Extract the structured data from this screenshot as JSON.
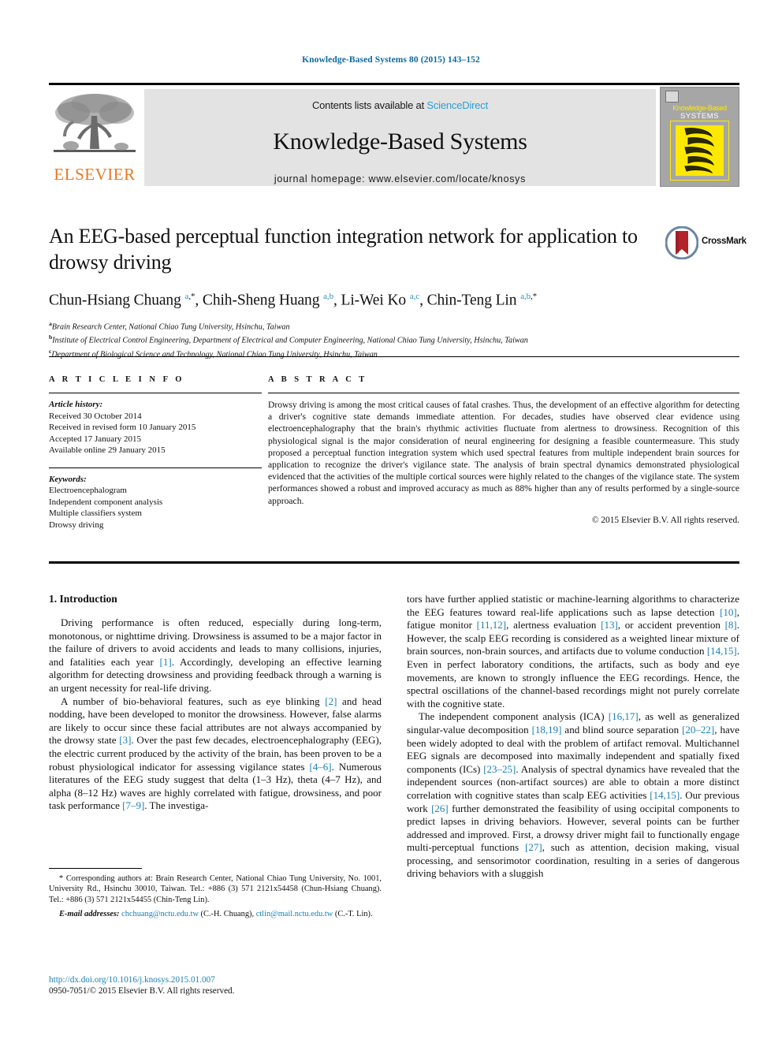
{
  "running_head": "Knowledge-Based Systems 80 (2015) 143–152",
  "masthead": {
    "elsevier_wordmark": "ELSEVIER",
    "contents_prefix": "Contents lists available at ",
    "sciencedirect": "ScienceDirect",
    "journal_title": "Knowledge-Based Systems",
    "homepage": "journal homepage: www.elsevier.com/locate/knosys",
    "cover": {
      "line1": "Knowledge-Based",
      "line2": "SYSTEMS"
    }
  },
  "article": {
    "title": "An EEG-based perceptual function integration network for application to drowsy driving",
    "crossmark_label": "CrossMark",
    "authors_html": "Chun-Hsiang Chuang <sup class=\"sup\">a</sup><sup class=\"sup sup-star\">,*</sup>, Chih-Sheng Huang <sup class=\"sup\">a,b</sup>, Li-Wei Ko <sup class=\"sup\">a,c</sup>, Chin-Teng Lin <sup class=\"sup\">a,b</sup><sup class=\"sup sup-star\">,*</sup>",
    "affiliations": [
      {
        "label": "a",
        "text": "Brain Research Center, National Chiao Tung University, Hsinchu, Taiwan"
      },
      {
        "label": "b",
        "text": "Institute of Electrical Control Engineering, Department of Electrical and Computer Engineering, National Chiao Tung University, Hsinchu, Taiwan"
      },
      {
        "label": "c",
        "text": "Department of Biological Science and Technology, National Chiao Tung University, Hsinchu, Taiwan"
      }
    ]
  },
  "article_info": {
    "heading": "A R T I C L E   I N F O",
    "history_label": "Article history:",
    "history": [
      "Received 30 October 2014",
      "Received in revised form 10 January 2015",
      "Accepted 17 January 2015",
      "Available online 29 January 2015"
    ],
    "keywords_label": "Keywords:",
    "keywords": [
      "Electroencephalogram",
      "Independent component analysis",
      "Multiple classifiers system",
      "Drowsy driving"
    ]
  },
  "abstract": {
    "heading": "A B S T R A C T",
    "text": "Drowsy driving is among the most critical causes of fatal crashes. Thus, the development of an effective algorithm for detecting a driver's cognitive state demands immediate attention. For decades, studies have observed clear evidence using electroencephalography that the brain's rhythmic activities fluctuate from alertness to drowsiness. Recognition of this physiological signal is the major consideration of neural engineering for designing a feasible countermeasure. This study proposed a perceptual function integration system which used spectral features from multiple independent brain sources for application to recognize the driver's vigilance state. The analysis of brain spectral dynamics demonstrated physiological evidenced that the activities of the multiple cortical sources were highly related to the changes of the vigilance state. The system performances showed a robust and improved accuracy as much as 88% higher than any of results performed by a single-source approach.",
    "copyright": "© 2015 Elsevier B.V. All rights reserved."
  },
  "body": {
    "section_title": "1. Introduction",
    "left_paragraphs": [
      "Driving performance is often reduced, especially during long-term, monotonous, or nighttime driving. Drowsiness is assumed to be a major factor in the failure of drivers to avoid accidents and leads to many collisions, injuries, and fatalities each year <span class=\"ref\">[1]</span>. Accordingly, developing an effective learning algorithm for detecting drowsiness and providing feedback through a warning is an urgent necessity for real-life driving.",
      "A number of bio-behavioral features, such as eye blinking <span class=\"ref\">[2]</span> and head nodding, have been developed to monitor the drowsiness. However, false alarms are likely to occur since these facial attributes are not always accompanied by the drowsy state <span class=\"ref\">[3]</span>. Over the past few decades, electroencephalography (EEG), the electric current produced by the activity of the brain, has been proven to be a robust physiological indicator for assessing vigilance states <span class=\"ref\">[4–6]</span>. Numerous literatures of the EEG study suggest that delta (1–3 Hz), theta (4–7 Hz), and alpha (8–12 Hz) waves are highly correlated with fatigue, drowsiness, and poor task performance <span class=\"ref\">[7–9]</span>. The investiga-"
    ],
    "right_paragraphs": [
      "tors have further applied statistic or machine-learning algorithms to characterize the EEG features toward real-life applications such as lapse detection <span class=\"ref\">[10]</span>, fatigue monitor <span class=\"ref\">[11,12]</span>, alertness evaluation <span class=\"ref\">[13]</span>, or accident prevention <span class=\"ref\">[8]</span>. However, the scalp EEG recording is considered as a weighted linear mixture of brain sources, non-brain sources, and artifacts due to volume conduction <span class=\"ref\">[14,15]</span>. Even in perfect laboratory conditions, the artifacts, such as body and eye movements, are known to strongly influence the EEG recordings. Hence, the spectral oscillations of the channel-based recordings might not purely correlate with the cognitive state.",
      "The independent component analysis (ICA) <span class=\"ref\">[16,17]</span>, as well as generalized singular-value decomposition <span class=\"ref\">[18,19]</span> and blind source separation <span class=\"ref\">[20–22]</span>, have been widely adopted to deal with the problem of artifact removal. Multichannel EEG signals are decomposed into maximally independent and spatially fixed components (ICs) <span class=\"ref\">[23–25]</span>. Analysis of spectral dynamics have revealed that the independent sources (non-artifact sources) are able to obtain a more distinct correlation with cognitive states than scalp EEG activities <span class=\"ref\">[14,15]</span>. Our previous work <span class=\"ref\">[26]</span> further demonstrated the feasibility of using occipital components to predict lapses in driving behaviors. However, several points can be further addressed and improved. First, a drowsy driver might fail to functionally engage multi-perceptual functions <span class=\"ref\">[27]</span>, such as attention, decision making, visual processing, and sensorimotor coordination, resulting in a series of dangerous driving behaviors with a sluggish"
    ]
  },
  "footnotes": {
    "corresponding": "* Corresponding authors at: Brain Research Center, National Chiao Tung University, No. 1001, University Rd., Hsinchu 30010, Taiwan. Tel.: +886 (3) 571 2121x54458 (Chun-Hsiang Chuang). Tel.: +886 (3) 571 2121x54455 (Chin-Teng Lin).",
    "email_html": "<em>E-mail addresses:</em> <span class=\"mail\">chchuang@nctu.edu.tw</span> (C.-H. Chuang), <span class=\"mail\">ctlin@mail.nctu.edu.tw</span> (C.-T. Lin).",
    "doi": "http://dx.doi.org/10.1016/j.knosys.2015.01.007",
    "issn": "0950-7051/© 2015 Elsevier B.V. All rights reserved."
  }
}
